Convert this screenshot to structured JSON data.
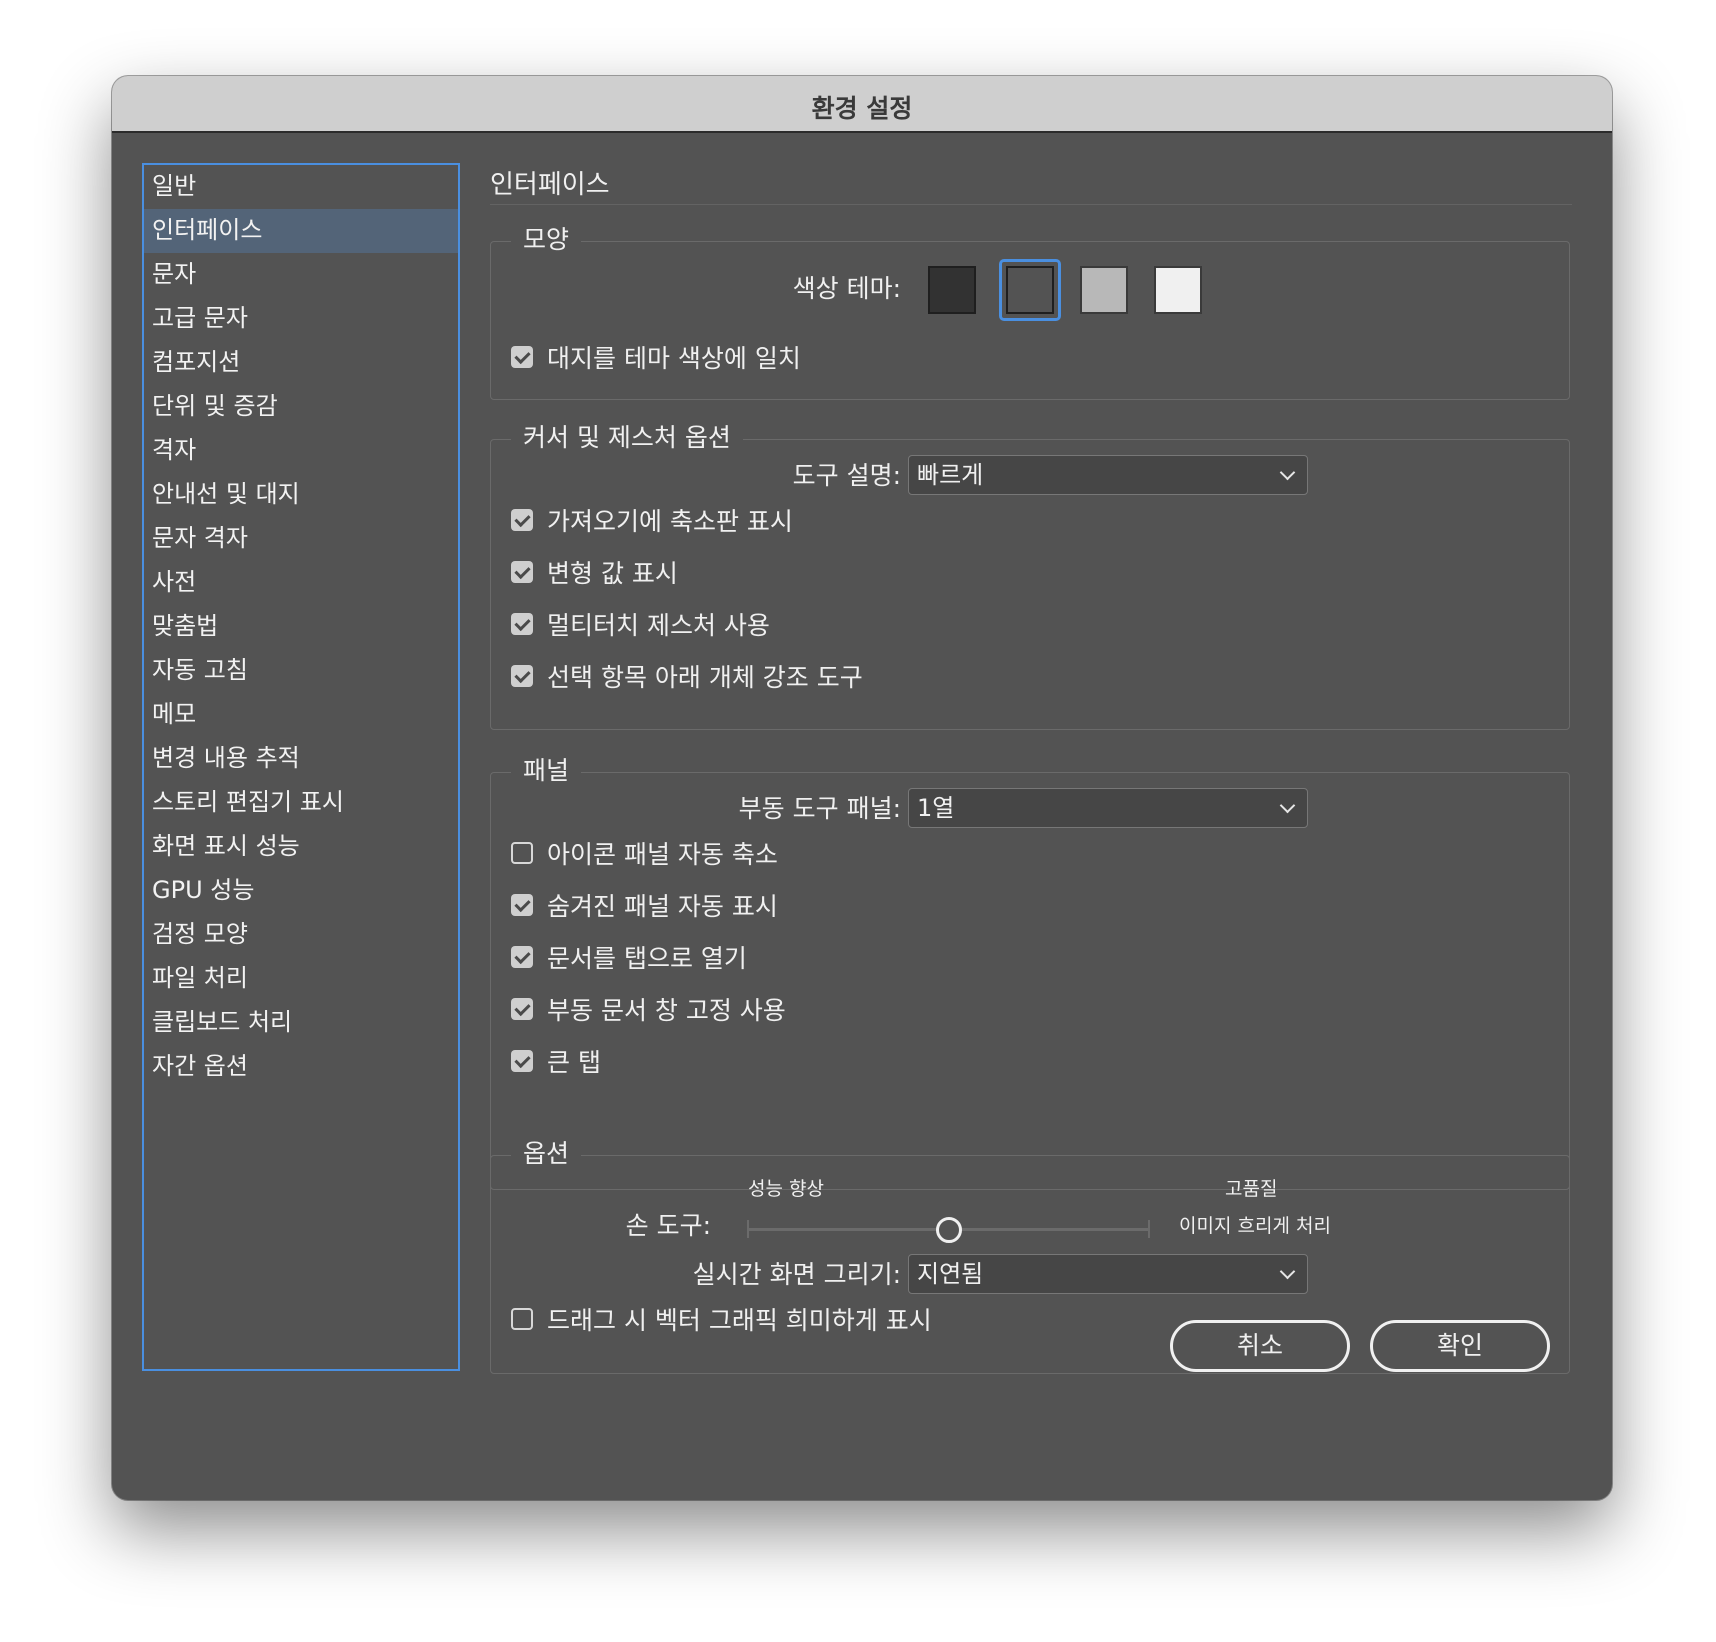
{
  "window": {
    "title": "환경 설정"
  },
  "sidebar": {
    "items": [
      {
        "label": "일반"
      },
      {
        "label": "인터페이스",
        "selected": true
      },
      {
        "label": "문자"
      },
      {
        "label": "고급 문자"
      },
      {
        "label": "컴포지션"
      },
      {
        "label": "단위 및 증감"
      },
      {
        "label": "격자"
      },
      {
        "label": "안내선 및 대지"
      },
      {
        "label": "문자 격자"
      },
      {
        "label": "사전"
      },
      {
        "label": "맞춤법"
      },
      {
        "label": "자동 고침"
      },
      {
        "label": "메모"
      },
      {
        "label": "변경 내용 추적"
      },
      {
        "label": "스토리 편집기 표시"
      },
      {
        "label": "화면 표시 성능"
      },
      {
        "label": "GPU 성능"
      },
      {
        "label": "검정 모양"
      },
      {
        "label": "파일 처리"
      },
      {
        "label": "클립보드 처리"
      },
      {
        "label": "자간 옵션"
      }
    ]
  },
  "main": {
    "section_title": "인터페이스",
    "appearance": {
      "legend": "모양",
      "theme_label": "색상 테마:",
      "themes": [
        {
          "name": "dark",
          "color": "#323232"
        },
        {
          "name": "medium-dark",
          "color": "#535353",
          "selected": true
        },
        {
          "name": "medium-light",
          "color": "#b8b8b8"
        },
        {
          "name": "light",
          "color": "#f0f0f0"
        }
      ],
      "match_pasteboard": {
        "label": "대지를 테마 색상에 일치",
        "checked": true
      }
    },
    "cursor": {
      "legend": "커서 및 제스처 옵션",
      "tooltip_label": "도구 설명:",
      "tooltip_value": "빠르게",
      "options": [
        {
          "label": "가져오기에 축소판 표시",
          "checked": true
        },
        {
          "label": "변형 값 표시",
          "checked": true
        },
        {
          "label": "멀티터치 제스처 사용",
          "checked": true
        },
        {
          "label": "선택 항목 아래 개체 강조 도구",
          "checked": true
        }
      ]
    },
    "panels": {
      "legend": "패널",
      "floating_label": "부동 도구 패널:",
      "floating_value": "1열",
      "options": [
        {
          "label": "아이콘 패널 자동 축소",
          "checked": false
        },
        {
          "label": "숨겨진 패널 자동 표시",
          "checked": true
        },
        {
          "label": "문서를 탭으로 열기",
          "checked": true
        },
        {
          "label": "부동 문서 창 고정 사용",
          "checked": true
        },
        {
          "label": "큰 탭",
          "checked": true
        }
      ]
    },
    "options": {
      "legend": "옵션",
      "hand_tool_label": "손 도구:",
      "slider_left_label": "성능 향상",
      "slider_right_label": "고품질",
      "slider_right_sub": "이미지 흐리게 처리",
      "slider_value": 0.5,
      "live_draw_label": "실시간 화면 그리기:",
      "live_draw_value": "지연됨",
      "greek_vector": {
        "label": "드래그 시 벡터 그래픽 희미하게 표시",
        "checked": false
      }
    }
  },
  "buttons": {
    "cancel": "취소",
    "ok": "확인"
  }
}
